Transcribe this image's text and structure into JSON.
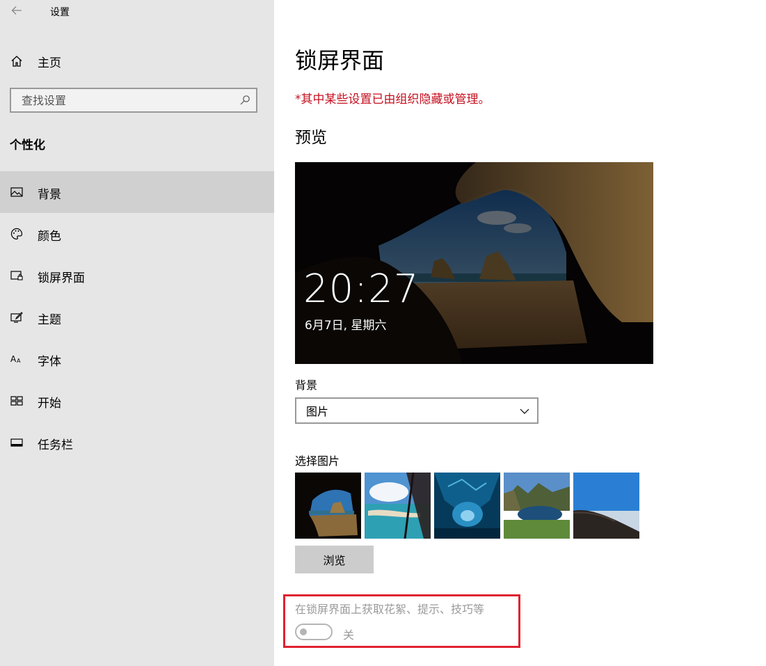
{
  "window": {
    "title": "设置"
  },
  "sidebar": {
    "home_label": "主页",
    "search_placeholder": "查找设置",
    "section_title": "个性化",
    "items": [
      {
        "label": "背景",
        "icon": "picture-icon",
        "selected": true
      },
      {
        "label": "颜色",
        "icon": "palette-icon",
        "selected": false
      },
      {
        "label": "锁屏界面",
        "icon": "lock-screen-icon",
        "selected": false
      },
      {
        "label": "主题",
        "icon": "theme-brush-icon",
        "selected": false
      },
      {
        "label": "字体",
        "icon": "font-icon",
        "selected": false
      },
      {
        "label": "开始",
        "icon": "start-grid-icon",
        "selected": false
      },
      {
        "label": "任务栏",
        "icon": "taskbar-icon",
        "selected": false
      }
    ]
  },
  "main": {
    "title": "锁屏界面",
    "org_notice": "*其中某些设置已由组织隐藏或管理。",
    "preview_heading": "预览",
    "preview": {
      "time": "20:27",
      "date": "6月7日, 星期六"
    },
    "background_label": "背景",
    "background_value": "图片",
    "choose_picture_label": "选择图片",
    "browse_label": "浏览",
    "spotlight_label": "在锁屏界面上获取花絮、提示、技巧等",
    "spotlight_toggle_state": "关",
    "spotlight_toggle_on": false
  },
  "colors": {
    "sidebar_bg": "#e6e6e6",
    "selected_item_bg": "#d0d0d0",
    "notice_red": "#c50f1f",
    "highlight_red": "#e02130"
  }
}
